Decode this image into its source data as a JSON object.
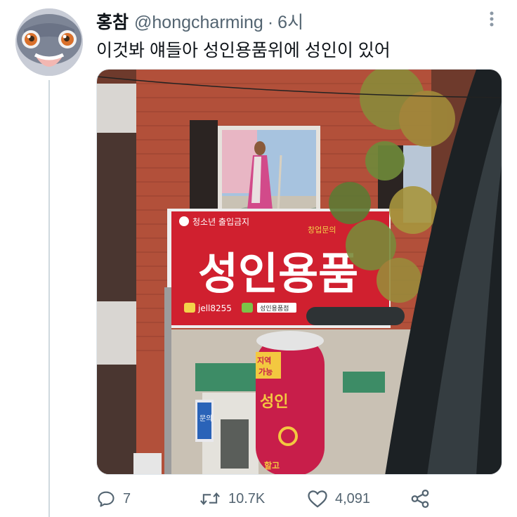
{
  "tweet": {
    "display_name": "홍참",
    "handle": "@hongcharming",
    "separator": "·",
    "time": "6시",
    "text": "이것봐 얘들아 성인용품위에 성인이 있어",
    "more_icon": "more-dots-icon"
  },
  "photo": {
    "shop_sign_main": "성인용품",
    "shop_sign_top_left": "청소년 출입금지",
    "shop_sign_top_right": "창업문의",
    "shop_sign_contact": "jell8255",
    "shop_sign_tag": "성인용품점",
    "tube_sign_top": "지역",
    "tube_sign_sub": "가능",
    "tube_sign_vertical": "성인",
    "tube_sign_bottom": "할고",
    "door_sign": "문의"
  },
  "actions": {
    "replies": "7",
    "retweets": "10.7K",
    "likes": "4,091",
    "reply_icon": "reply-icon",
    "retweet_icon": "retweet-icon",
    "like_icon": "heart-icon",
    "share_icon": "share-icon"
  }
}
